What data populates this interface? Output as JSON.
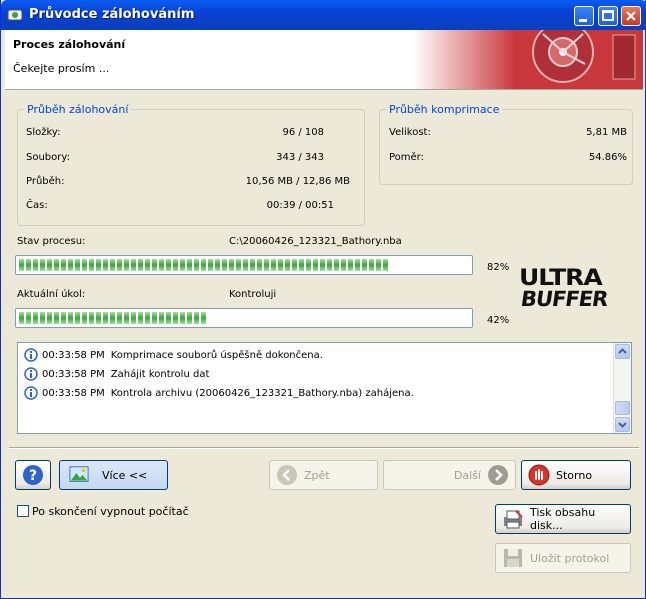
{
  "window": {
    "title": "Průvodce zálohováním"
  },
  "header": {
    "title": "Proces zálohování",
    "subtitle": "Čekejte prosím ..."
  },
  "backup_group": {
    "title": "Průběh zálohování",
    "rows": [
      {
        "label": "Složky:",
        "value": "96 / 108"
      },
      {
        "label": "Soubory:",
        "value": "343 / 343"
      },
      {
        "label": "Průběh:",
        "value": "10,56 MB / 12,86 MB"
      },
      {
        "label": "Čas:",
        "value": "00:39 / 00:51"
      }
    ]
  },
  "compress_group": {
    "title": "Průběh komprimace",
    "rows": [
      {
        "label": "Velikost:",
        "value": "5,81 MB"
      },
      {
        "label": "Poměr:",
        "value": "54.86%"
      }
    ]
  },
  "process": {
    "label": "Stav procesu:",
    "file": "C:\\20060426_123321_Bathory.nba",
    "percent_text": "82%",
    "progress": 0.82
  },
  "task": {
    "label": "Aktuální úkol:",
    "value": "Kontroluji",
    "percent_text": "42%",
    "progress": 0.42
  },
  "logo": {
    "line1": "ULTRA",
    "line2": "BUFFER"
  },
  "log": [
    {
      "time": "00:33:58 PM",
      "text": "Komprimace souborů úspěšně dokončena."
    },
    {
      "time": "00:33:58 PM",
      "text": "Zahájit kontrolu dat"
    },
    {
      "time": "00:33:58 PM",
      "text": "Kontrola archivu (20060426_123321_Bathory.nba) zahájena."
    }
  ],
  "buttons": {
    "help": "?",
    "more": "Více <<",
    "back": "Zpět",
    "next": "Další",
    "cancel": "Storno",
    "print": "Tisk obsahu disk...",
    "save_log": "Uložit protokol"
  },
  "checkbox": {
    "label": "Po skončení vypnout počítač",
    "checked": false
  },
  "colors": {
    "accent": "#0046d5",
    "progress_green": "#3ca33c",
    "title_bar": "#0842d6"
  }
}
